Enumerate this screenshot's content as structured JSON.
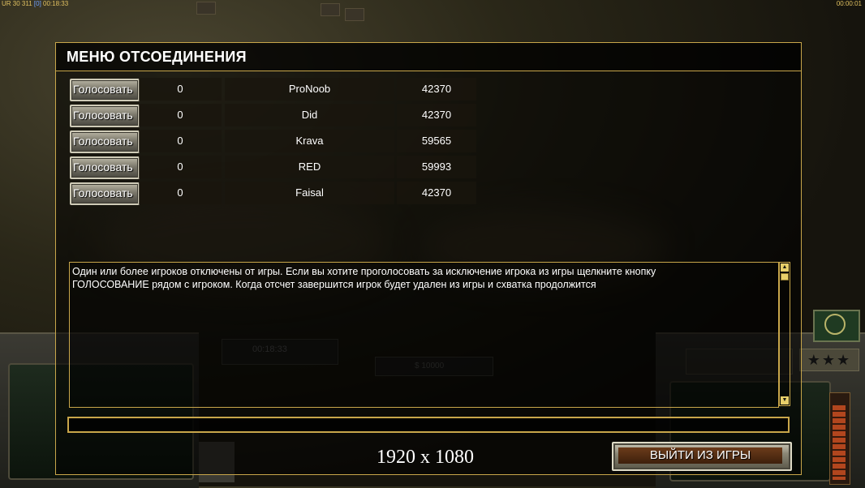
{
  "hud": {
    "top_left_info": "UR 30 311 [0] 00:18:33",
    "top_left_prefix": "UR 30 311",
    "top_left_bracket": "[0]",
    "top_left_time": "00:18:33",
    "top_right_time": "00:00:01",
    "background_timer": "00:18:33",
    "background_money": "$ 10000"
  },
  "dialog": {
    "title": "МЕНЮ ОТСОЕДИНЕНИЯ",
    "players": [
      {
        "vote_label": "Голосовать",
        "votes": "0",
        "name": "ProNoob",
        "ping": "42370"
      },
      {
        "vote_label": "Голосовать",
        "votes": "0",
        "name": "Did",
        "ping": "42370"
      },
      {
        "vote_label": "Голосовать",
        "votes": "0",
        "name": "Krava",
        "ping": "59565"
      },
      {
        "vote_label": "Голосовать",
        "votes": "0",
        "name": "RED",
        "ping": "59993"
      },
      {
        "vote_label": "Голосовать",
        "votes": "0",
        "name": "Faisal",
        "ping": "42370"
      }
    ],
    "message": "Один или более игроков отключены от игры. Если вы хотите проголосовать за исключение игрока из игры щелкните кнопку\n ГОЛОСОВАНИЕ рядом с игроком. Когда отсчет завершится игрок будет удален из игры и схватка продолжится",
    "chat_input_value": "",
    "resolution_label": "1920 x 1080",
    "quit_button": "ВЫЙТИ ИЗ ИГРЫ"
  },
  "colors": {
    "frame_gold": "#c8a64a",
    "text_white": "#ffffff",
    "hud_yellow": "#e0c060"
  },
  "icons": {
    "scroll_up": "triangle-up-icon",
    "scroll_down": "triangle-down-icon",
    "rank_stars": "star-icon"
  }
}
